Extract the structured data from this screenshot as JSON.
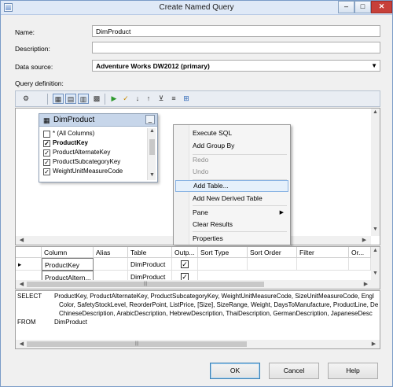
{
  "window": {
    "title": "Create Named Query",
    "min": "–",
    "max": "□",
    "close": "✕"
  },
  "form": {
    "name_label": "Name:",
    "name_value": "DimProduct",
    "description_label": "Description:",
    "description_value": "",
    "datasource_label": "Data source:",
    "datasource_value": "Adventure Works DW2012 (primary)",
    "query_label": "Query definition:"
  },
  "toolbar": {
    "icons": [
      "manage-relationships-icon",
      "show-diagram-pane-icon",
      "show-grid-pane-icon",
      "show-sql-pane-icon",
      "show-results-pane-icon",
      "run-icon",
      "verify-sql-icon",
      "sort-ascending-icon",
      "sort-descending-icon",
      "remove-filter-icon",
      "group-by-icon",
      "add-table-icon"
    ]
  },
  "diagram": {
    "table": {
      "name": "DimProduct",
      "minimize": "_",
      "columns": [
        {
          "label": "* (All Columns)",
          "checked": false,
          "bold": false
        },
        {
          "label": "ProductKey",
          "checked": true,
          "bold": true
        },
        {
          "label": "ProductAlternateKey",
          "checked": true,
          "bold": false
        },
        {
          "label": "ProductSubcategoryKey",
          "checked": true,
          "bold": false
        },
        {
          "label": "WeightUnitMeasureCode",
          "checked": true,
          "bold": false
        }
      ]
    },
    "context_menu": [
      {
        "label": "Execute SQL",
        "state": "enabled"
      },
      {
        "label": "Add Group By",
        "state": "enabled"
      },
      {
        "label": "Redo",
        "state": "disabled"
      },
      {
        "label": "Undo",
        "state": "disabled"
      },
      {
        "label": "Add Table...",
        "state": "hot"
      },
      {
        "label": "Add New Derived Table",
        "state": "enabled"
      },
      {
        "label": "Pane",
        "state": "submenu"
      },
      {
        "label": "Clear Results",
        "state": "enabled"
      },
      {
        "label": "Properties",
        "state": "enabled"
      }
    ]
  },
  "grid": {
    "headers": [
      "Column",
      "Alias",
      "Table",
      "Outp...",
      "Sort Type",
      "Sort Order",
      "Filter",
      "Or..."
    ],
    "rows": [
      {
        "column": "ProductKey",
        "alias": "",
        "table": "DimProduct",
        "output": true
      },
      {
        "column": "ProductAltern...",
        "alias": "",
        "table": "DimProduct",
        "output": true
      }
    ]
  },
  "sql": {
    "select_kw": "SELECT",
    "from_kw": "FROM",
    "lines": [
      "ProductKey, ProductAlternateKey, ProductSubcategoryKey, WeightUnitMeasureCode, SizeUnitMeasureCode, Engl",
      "Color, SafetyStockLevel, ReorderPoint, ListPrice, [Size], SizeRange, Weight, DaysToManufacture, ProductLine, De",
      "ChineseDescription, ArabicDescription, HebrewDescription, ThaiDescription, GermanDescription, JapaneseDesc"
    ],
    "from_value": "DimProduct"
  },
  "buttons": {
    "ok": "OK",
    "cancel": "Cancel",
    "help": "Help"
  }
}
